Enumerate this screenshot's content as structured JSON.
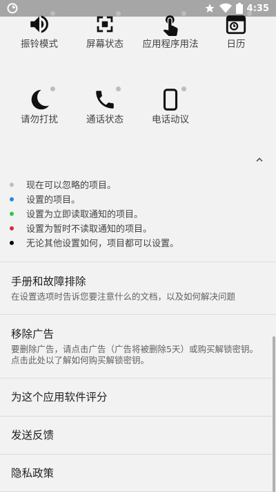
{
  "status_bar": {
    "time": "4:35",
    "icons": [
      "app-notification-icon",
      "star-icon",
      "wifi-icon",
      "battery-icon"
    ]
  },
  "grid": {
    "row1": [
      {
        "label": "振铃模式",
        "icon": "volume-icon"
      },
      {
        "label": "屏幕状态",
        "icon": "screen-state-icon"
      },
      {
        "label": "应用程序用法",
        "icon": "touch-icon"
      },
      {
        "label": "日历",
        "icon": "calendar-icon"
      }
    ],
    "row2": [
      {
        "label": "请勿打扰",
        "icon": "moon-icon"
      },
      {
        "label": "通话状态",
        "icon": "phone-icon"
      },
      {
        "label": "电话动议",
        "icon": "smartphone-icon"
      }
    ]
  },
  "legend": [
    {
      "text": "现在可以忽略的项目。",
      "color": "#bdbdbd"
    },
    {
      "text": "设置的项目。",
      "color": "#1e88e5"
    },
    {
      "text": "设置为立即读取通知的项目。",
      "color": "#2ecc40"
    },
    {
      "text": "设置为暂时不读取通知的项目。",
      "color": "#d32f2f"
    },
    {
      "text": "无论其他设置如何，项目都可以设置。",
      "color": "#000000"
    }
  ],
  "settings": [
    {
      "title": "手册和故障排除",
      "summary": "在设置选项时告诉您要注意什么的文档，以及如何解决问题"
    },
    {
      "title": "移除广告",
      "summary": "要删除广告，请点击广告（广告将被删除5天）或购买解锁密钥。点击此处以了解如何购买解锁密钥。"
    },
    {
      "title": "为这个应用软件评分",
      "summary": ""
    },
    {
      "title": "发送反馈",
      "summary": ""
    },
    {
      "title": "隐私政策",
      "summary": ""
    }
  ]
}
